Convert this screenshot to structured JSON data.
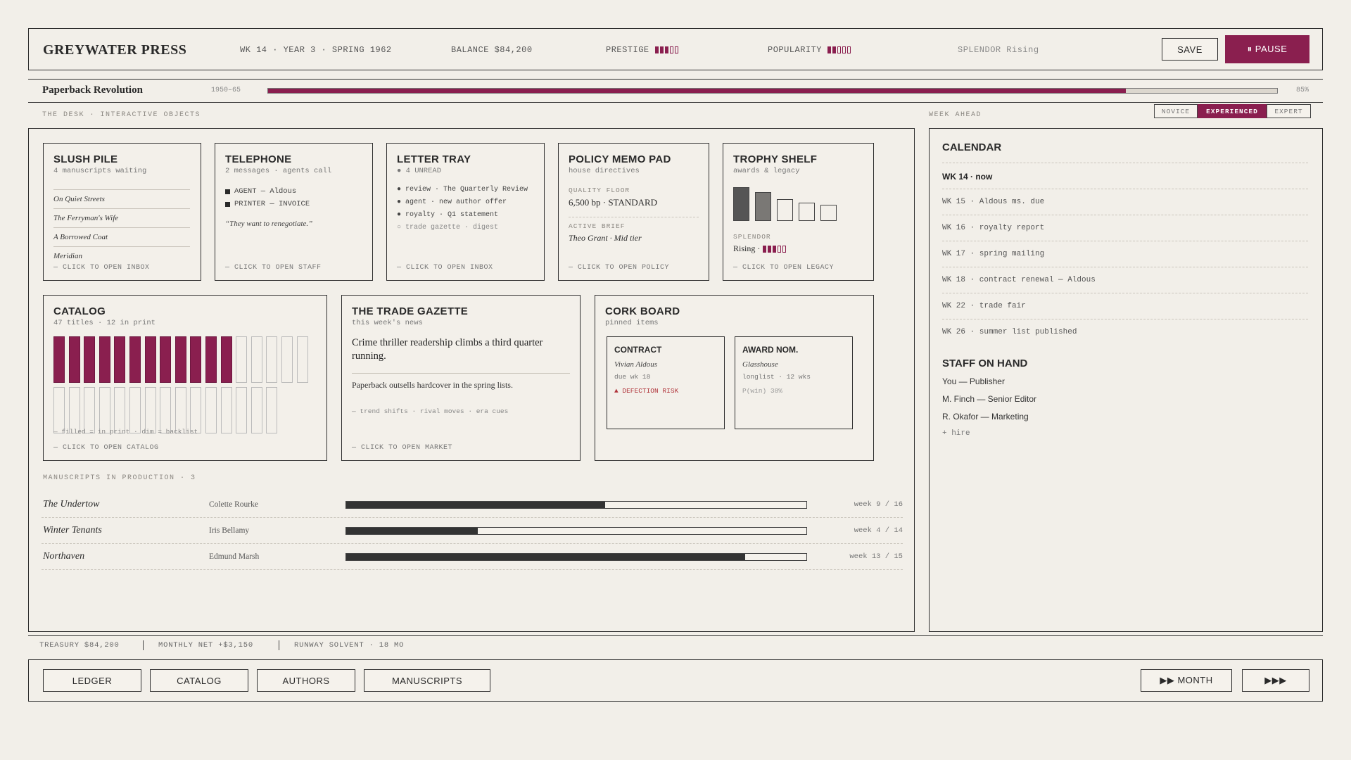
{
  "topbar": {
    "studio_name": "GREYWATER PRESS",
    "date": "WK 14 · YEAR 3 · SPRING 1962",
    "balance": "BALANCE $84,200",
    "prestige_label": "PRESTIGE",
    "prestige_level": 3,
    "prestige_max": 5,
    "popularity_label": "POPULARITY",
    "popularity_level": 2,
    "popularity_max": 5,
    "splendor": "SPLENDOR Rising",
    "save_label": "SAVE",
    "pause_label": "⏸ PAUSE"
  },
  "era": {
    "name": "Paperback Revolution",
    "years": "1950–65",
    "progress_fraction": 0.85,
    "progress_label": "85%"
  },
  "desk": {
    "section_label": "THE DESK · INTERACTIVE OBJECTS",
    "slush": {
      "title": "SLUSH PILE",
      "subtitle": "4 manuscripts waiting",
      "items": [
        "On Quiet Streets",
        "The Ferryman's Wife",
        "A Borrowed Coat",
        "Meridian"
      ],
      "cta": "— CLICK TO OPEN INBOX"
    },
    "telephone": {
      "title": "TELEPHONE",
      "subtitle": "2 messages · agents call",
      "lines": [
        "AGENT — Aldous",
        "PRINTER — INVOICE"
      ],
      "quote": "“They want to renegotiate.”",
      "cta": "— CLICK TO OPEN STAFF"
    },
    "letters": {
      "title": "LETTER TRAY",
      "subtitle": "● 4 UNREAD",
      "lines": [
        "● review · The Quarterly Review",
        "● agent · new author offer",
        "● royalty · Q1 statement",
        "○ trade gazette · digest"
      ],
      "cta": "— CLICK TO OPEN INBOX"
    },
    "policy": {
      "title": "POLICY MEMO PAD",
      "subtitle": "house directives",
      "quality_label": "QUALITY FLOOR",
      "quality_value": "6,500 bp · STANDARD",
      "brief_label": "ACTIVE BRIEF",
      "brief_value": "Theo Grant · Mid tier",
      "cta": "— CLICK TO OPEN POLICY"
    },
    "trophy": {
      "title": "TROPHY SHELF",
      "subtitle": "awards & legacy",
      "splendor_label": "SPLENDOR",
      "splendor_value": "Rising ·",
      "splendor_level": 3,
      "splendor_max": 5,
      "cta": "— CLICK TO OPEN LEGACY"
    },
    "catalog": {
      "title": "CATALOG",
      "subtitle": "47 titles · 12 in print",
      "in_print": 12,
      "top_row_slots": 17,
      "bottom_row_slots": 15,
      "legend": "— filled = in print · dim = backlist",
      "cta": "— CLICK TO OPEN CATALOG"
    },
    "gazette": {
      "title": "THE TRADE GAZETTE",
      "subtitle": "this week's news",
      "headline": "Crime thriller readership climbs a third quarter running.",
      "story": "Paperback outsells hardcover in the spring lists.",
      "tags": "— trend shifts · rival moves · era cues",
      "cta": "— CLICK TO OPEN MARKET"
    },
    "corkboard": {
      "title": "CORK BOARD",
      "subtitle": "pinned items",
      "contract": {
        "title": "CONTRACT",
        "name": "Vivian Aldous",
        "due": "due wk 18",
        "warning": "▲ DEFECTION RISK"
      },
      "award": {
        "title": "AWARD NOM.",
        "name": "Glasshouse",
        "detail": "longlist · 12 wks",
        "odds": "P(win) 38%"
      }
    },
    "production": {
      "section_label": "MANUSCRIPTS IN PRODUCTION · 3",
      "rows": [
        {
          "title": "The Undertow",
          "author": "Colette Rourke",
          "progress": 0.5625,
          "week": "week 9 / 16"
        },
        {
          "title": "Winter Tenants",
          "author": "Iris Bellamy",
          "progress": 0.2857,
          "week": "week 4 / 14"
        },
        {
          "title": "Northaven",
          "author": "Edmund Marsh",
          "progress": 0.8667,
          "week": "week 13 / 15"
        }
      ]
    }
  },
  "weekahead": {
    "section_label": "WEEK AHEAD",
    "difficulty": [
      "NOVICE",
      "EXPERIENCED",
      "EXPERT"
    ],
    "difficulty_active": "EXPERIENCED",
    "calendar_title": "CALENDAR",
    "calendar": [
      "WK 14 · now",
      "WK 15 · Aldous ms. due",
      "WK 16 · royalty report",
      "WK 17 · spring mailing",
      "WK 18 · contract renewal — Aldous",
      "WK 22 · trade fair",
      "WK 26 · summer list published"
    ],
    "staff_title": "STAFF ON HAND",
    "staff": [
      "You — Publisher",
      "M. Finch — Senior Editor",
      "R. Okafor — Marketing"
    ],
    "hire_label": "+ hire"
  },
  "footer": {
    "treasury": "TREASURY $84,200",
    "monthly_net": "MONTHLY NET +$3,150",
    "runway": "RUNWAY SOLVENT · 18 MO",
    "nav": [
      "LEDGER",
      "CATALOG",
      "AUTHORS",
      "MANUSCRIPTS"
    ],
    "month_label": "▶▶ MONTH",
    "fast_label": "▶▶▶"
  },
  "colors": {
    "accent": "#8a1f4f",
    "background": "#f2efe9",
    "ink": "#2a2a2a"
  }
}
